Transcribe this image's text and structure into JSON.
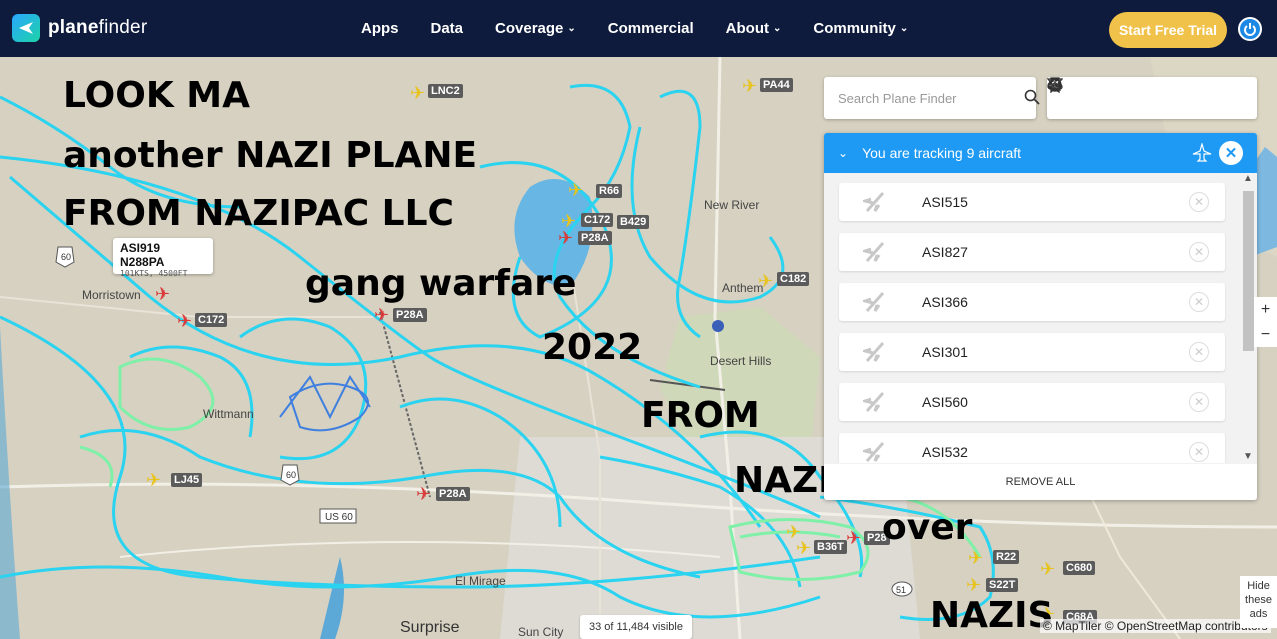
{
  "nav": {
    "logo_prefix": "plane",
    "logo_suffix": "finder",
    "items": [
      {
        "label": "Apps"
      },
      {
        "label": "Data"
      },
      {
        "label": "Coverage",
        "dropdown": true
      },
      {
        "label": "Commercial"
      },
      {
        "label": "About",
        "dropdown": true
      },
      {
        "label": "Community",
        "dropdown": true
      }
    ],
    "trial_button": "Start Free Trial"
  },
  "search": {
    "placeholder": "Search Plane Finder"
  },
  "tools": [
    "cloud-icon",
    "filter-icon",
    "bookmark-icon",
    "gear-icon",
    "history-icon",
    "plane-settings-icon"
  ],
  "panel": {
    "title": "You are tracking 9 aircraft",
    "items": [
      {
        "label": "ASI515"
      },
      {
        "label": "ASI827"
      },
      {
        "label": "ASI366"
      },
      {
        "label": "ASI301"
      },
      {
        "label": "ASI560"
      },
      {
        "label": "ASI532"
      }
    ],
    "footer": "REMOVE ALL"
  },
  "tooltip": {
    "title": "ASI919 N288PA",
    "subtitle": "101KTS, 4500FT"
  },
  "aircraft_labels": [
    "LNC2",
    "PA44",
    "R66",
    "C172",
    "B429",
    "P28A",
    "C182",
    "C172",
    "P28A",
    "LJ45",
    "P28A",
    "B36T",
    "P28",
    "R22",
    "C680",
    "S22T",
    "C68A"
  ],
  "places": [
    "Morristown",
    "Wittmann",
    "New River",
    "Anthem",
    "Desert Hills",
    "Surprise",
    "Sun City",
    "El Mirage"
  ],
  "highway_signs": [
    "60",
    "60",
    "US 60",
    "51"
  ],
  "overlay_text": {
    "line1": "LOOK MA",
    "line2": "another NAZI PLANE",
    "line3": "FROM NAZIPAC LLC",
    "line4": "gang warfare",
    "line5": "2022",
    "line6": "FROM",
    "line7": "NAZIs",
    "line8": "over",
    "line9": "NAZIS"
  },
  "status": {
    "visible_count": "33 of 11,484 visible",
    "attribution": "© MapTiler © OpenStreetMap contributors",
    "hide_ads": "Hide these ads"
  },
  "zoom": {
    "in": "+",
    "out": "−"
  },
  "colors": {
    "nav_bg": "#0e1b3d",
    "trial_bg": "#f1c24a",
    "accent_blue": "#1e9af4",
    "track_cyan": "#2ad3f0",
    "track_green": "#7ff0a8"
  }
}
